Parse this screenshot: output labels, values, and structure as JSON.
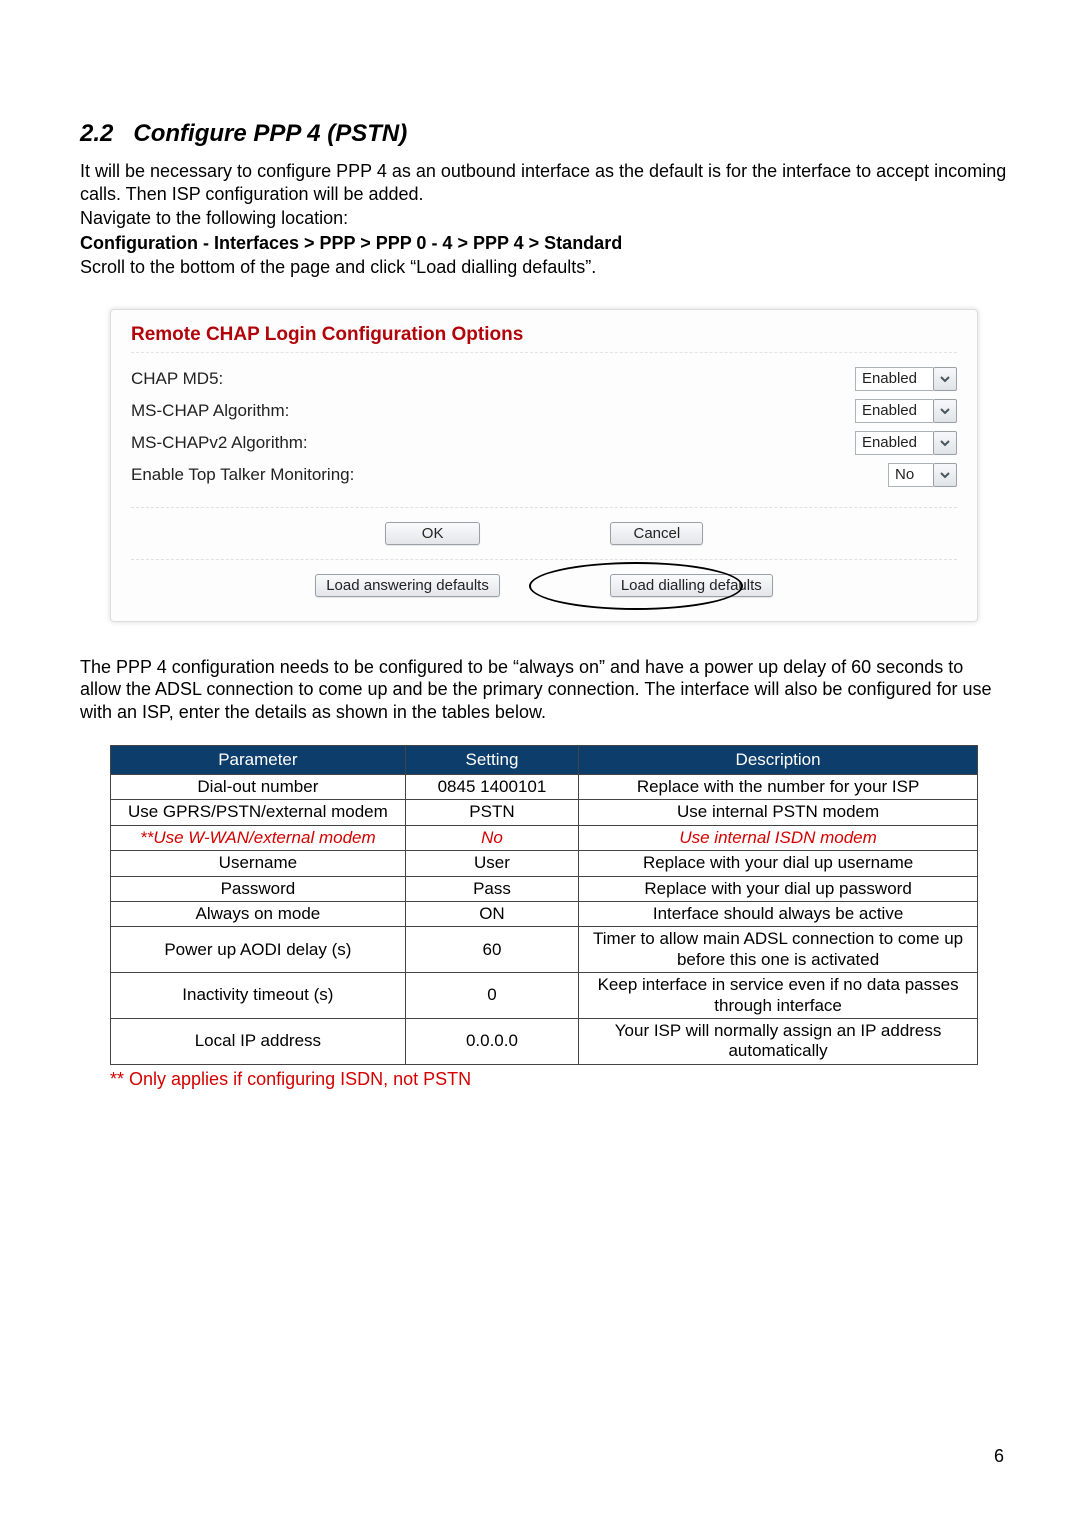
{
  "section": {
    "number": "2.2",
    "title": "Configure PPP 4 (PSTN)"
  },
  "intro": {
    "p1": "It will be necessary to configure PPP 4 as an outbound interface as the default is for the interface to accept incoming calls.   Then ISP configuration will be added.",
    "p2": "Navigate to the following location:",
    "breadcrumb": "Configuration - Interfaces > PPP > PPP 0 - 4 > PPP 4 > Standard",
    "p3": "Scroll to the bottom of the page and click “Load dialling defaults”."
  },
  "ui": {
    "panel_title": "Remote CHAP Login Configuration Options",
    "rows": [
      {
        "label": "CHAP MD5:",
        "value": "Enabled"
      },
      {
        "label": "MS-CHAP Algorithm:",
        "value": "Enabled"
      },
      {
        "label": "MS-CHAPv2 Algorithm:",
        "value": "Enabled"
      },
      {
        "label": "Enable Top Talker Monitoring:",
        "value": "No"
      }
    ],
    "ok_label": "OK",
    "cancel_label": "Cancel",
    "load_answering_label": "Load answering defaults",
    "load_dialling_label": "Load dialling defaults"
  },
  "post_ui_paragraph": "The PPP 4 configuration needs to be configured to be “always on” and have a power up delay of 60 seconds to allow the ADSL connection to come up and be the primary connection.  The interface will also be configured for use with an ISP, enter the details as shown in the tables below.",
  "table": {
    "headers": {
      "param": "Parameter",
      "setting": "Setting",
      "desc": "Description"
    },
    "rows": [
      {
        "param": "Dial-out number",
        "setting": "0845 1400101",
        "desc": "Replace with the number for your ISP",
        "red": false
      },
      {
        "param": "Use GPRS/PSTN/external modem",
        "setting": "PSTN",
        "desc": "Use internal PSTN modem",
        "red": false
      },
      {
        "param": "**Use W-WAN/external modem",
        "setting": "No",
        "desc": "Use internal ISDN modem",
        "red": true
      },
      {
        "param": "Username",
        "setting": "User",
        "desc": "Replace with your dial up username",
        "red": false
      },
      {
        "param": "Password",
        "setting": "Pass",
        "desc": "Replace with your dial up password",
        "red": false
      },
      {
        "param": "Always on mode",
        "setting": "ON",
        "desc": "Interface should always be active",
        "red": false
      },
      {
        "param": "Power up AODI delay (s)",
        "setting": "60",
        "desc": "Timer to allow main ADSL connection to come up before this one is activated",
        "red": false
      },
      {
        "param": "Inactivity timeout (s)",
        "setting": "0",
        "desc": "Keep interface in service even if no data passes through interface",
        "red": false
      },
      {
        "param": "Local IP address",
        "setting": "0.0.0.0",
        "desc": "Your ISP will normally assign an IP address automatically",
        "red": false
      }
    ]
  },
  "footnote": "** Only applies if configuring ISDN, not PSTN",
  "page_number": "6"
}
